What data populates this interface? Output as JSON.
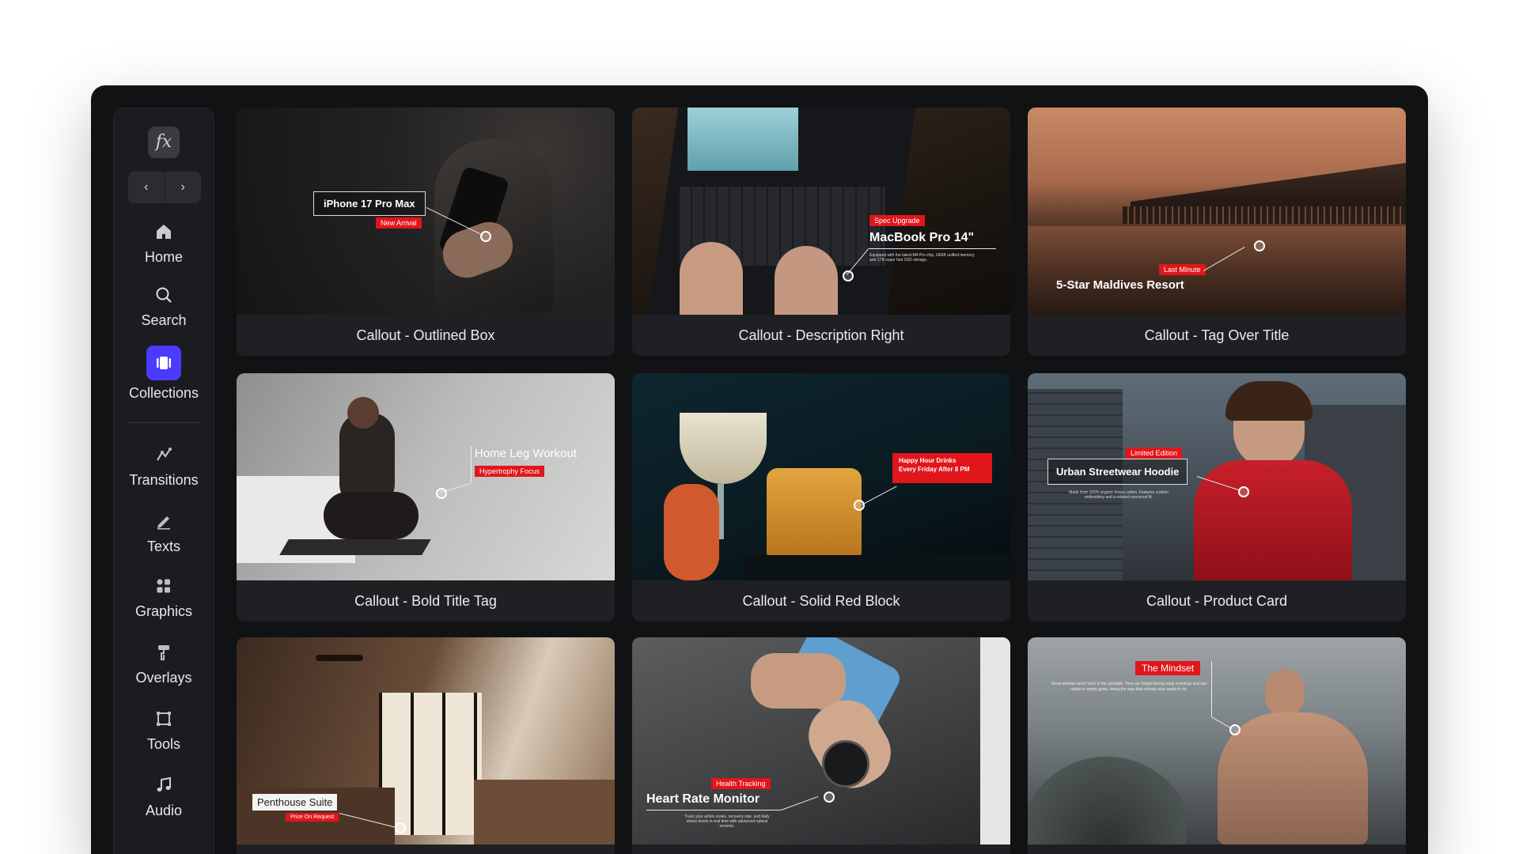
{
  "app": {
    "logo": "fx"
  },
  "nav": {
    "back_label": "‹",
    "forward_label": "›",
    "items": [
      {
        "label": "Home",
        "icon": "home-icon"
      },
      {
        "label": "Search",
        "icon": "search-icon"
      },
      {
        "label": "Collections",
        "icon": "collections-icon",
        "active": true,
        "accent": "#4b3bff"
      },
      {
        "label": "Transitions",
        "icon": "transitions-icon"
      },
      {
        "label": "Texts",
        "icon": "pen-icon"
      },
      {
        "label": "Graphics",
        "icon": "graphics-icon"
      },
      {
        "label": "Overlays",
        "icon": "paint-roller-icon"
      },
      {
        "label": "Tools",
        "icon": "tools-icon"
      },
      {
        "label": "Audio",
        "icon": "music-note-icon"
      }
    ]
  },
  "cards": [
    {
      "caption": "Callout - Outlined Box",
      "overlay": {
        "title": "iPhone 17 Pro Max",
        "tag": "New Arrival"
      }
    },
    {
      "caption": "Callout - Description Right",
      "overlay": {
        "tag": "Spec Upgrade",
        "title": "MacBook Pro 14\"",
        "desc": "Equipped with the latest M4 Pro chip, 24GB unified memory, and 1TB super fast SSD storage."
      }
    },
    {
      "caption": "Callout - Tag Over Title",
      "overlay": {
        "tag": "Last Minute",
        "title": "5-Star Maldives Resort"
      }
    },
    {
      "caption": "Callout - Bold Title Tag",
      "overlay": {
        "title": "Home Leg Workout",
        "tag": "Hypertrophy Focus"
      }
    },
    {
      "caption": "Callout - Solid Red Block",
      "overlay": {
        "line1": "Happy Hour Drinks",
        "line2": "Every Friday After 8 PM"
      }
    },
    {
      "caption": "Callout - Product Card",
      "overlay": {
        "tag": "Limited Edition",
        "title": "Urban Streetwear Hoodie",
        "desc": "Made from 100% organic heavy cotton. Features custom embroidery and a relaxed oversized fit."
      }
    },
    {
      "caption": "",
      "overlay": {
        "title": "Penthouse Suite",
        "tag": "Price On Request"
      }
    },
    {
      "caption": "",
      "overlay": {
        "tag": "Health Tracking",
        "title": "Heart Rate Monitor",
        "desc": "Track your active zones, recovery rate, and daily stress levels in real time with advanced optical sensors."
      }
    },
    {
      "caption": "",
      "overlay": {
        "tag": "The Mindset",
        "desc": "Great athletes aren't born in the spotlight. They are forged during early mornings and late nights in empty gyms, doing the reps that nobody else wants to do."
      }
    }
  ],
  "colors": {
    "accent_red": "#e0161b",
    "bg": "#111214",
    "card": "#1f2023"
  }
}
